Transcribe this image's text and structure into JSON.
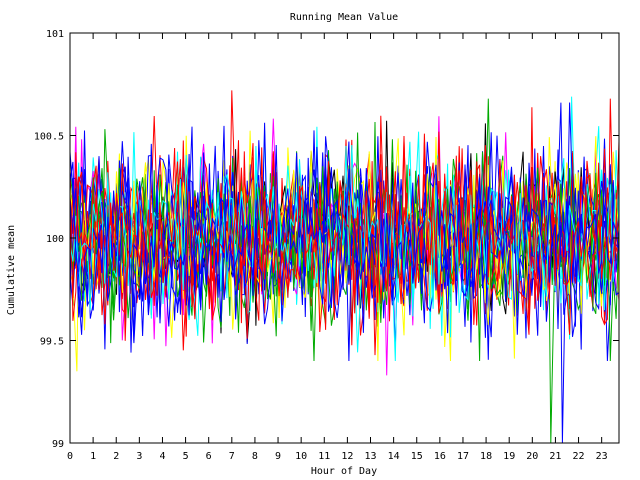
{
  "chart_data": {
    "type": "line",
    "title": "Running Mean Value",
    "xlabel": "Hour of Day",
    "ylabel": "Cumulative mean",
    "xlim": [
      0,
      23.75
    ],
    "ylim": [
      99,
      101
    ],
    "x_ticks": [
      "0",
      "1",
      "2",
      "3",
      "4",
      "5",
      "6",
      "7",
      "8",
      "9",
      "10",
      "11",
      "12",
      "13",
      "14",
      "15",
      "16",
      "17",
      "18",
      "19",
      "20",
      "21",
      "22",
      "23"
    ],
    "y_ticks": [
      "99",
      "99.5",
      "100",
      "100.5",
      "101"
    ],
    "grid": false,
    "legend": "none",
    "series_count": 24,
    "samples_per_series": 190,
    "series_spread_sd": 0.2,
    "series_mean": 100,
    "series_colors": [
      "#ff0000",
      "#00aa00",
      "#0000ff",
      "#00ffff",
      "#ff00ff",
      "#ffff00",
      "#000000",
      "#0000ff",
      "#ff0000",
      "#00aa00",
      "#0000ff",
      "#00ffff",
      "#ff0000",
      "#0000ff",
      "#00aa00",
      "#ff0000",
      "#0000ff",
      "#ffff00",
      "#00aa00",
      "#ff0000",
      "#0000ff",
      "#00ffff",
      "#ff0000",
      "#0000ff"
    ],
    "extreme_points": [
      {
        "x": 7.0,
        "y": 100.72
      },
      {
        "x": 20.8,
        "y": 99.0
      },
      {
        "x": 21.3,
        "y": 99.0
      },
      {
        "x": 21.7,
        "y": 100.69
      },
      {
        "x": 13.7,
        "y": 99.33
      },
      {
        "x": 0.3,
        "y": 99.35
      }
    ]
  }
}
